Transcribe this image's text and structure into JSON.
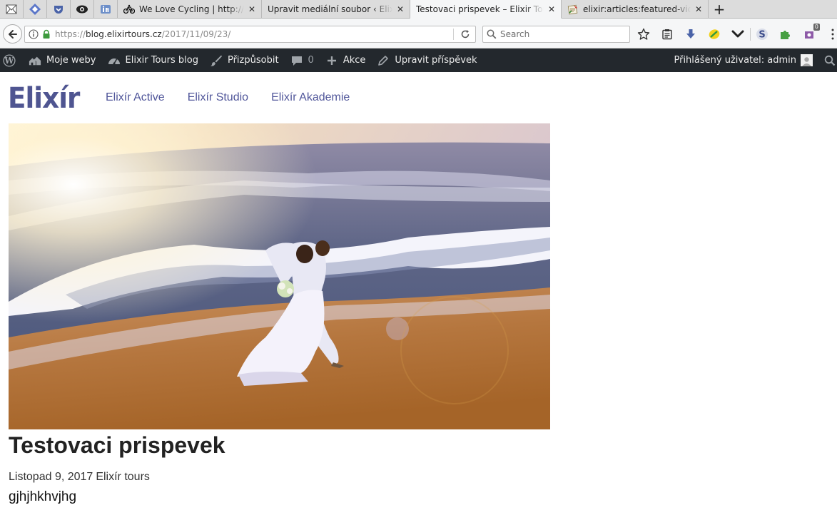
{
  "browser": {
    "tabs": [
      {
        "title": "We Love Cycling | http://w",
        "icon": "cycling-icon"
      },
      {
        "title": "Upravit mediální soubor ‹ Elixír",
        "icon": "none"
      },
      {
        "title": "Testovaci prispevek – Elixir Tours",
        "icon": "none",
        "selected": true
      },
      {
        "title": "elixir:articles:featured-video",
        "icon": "dokuwiki-icon"
      }
    ],
    "pinned_tabs": [
      "mail-icon",
      "diamond-icon",
      "pocket-icon",
      "eye-icon",
      "linkedin-icon"
    ],
    "new_tab_label": "+",
    "close_glyph": "✕",
    "url": {
      "scheme": "https://",
      "host": "blog.elixirtours.cz",
      "path": "/2017/11/09/23/"
    },
    "search_placeholder": "Search",
    "extension_badge": "0"
  },
  "adminbar": {
    "items": [
      {
        "label": "",
        "icon": "wordpress-icon"
      },
      {
        "label": "Moje weby",
        "icon": "sites-icon"
      },
      {
        "label": "Elixir Tours blog",
        "icon": "dashboard-icon"
      },
      {
        "label": "Přizpůsobit",
        "icon": "brush-icon"
      },
      {
        "label": "0",
        "icon": "comment-icon"
      },
      {
        "label": "Akce",
        "icon": "plus-icon"
      },
      {
        "label": "Upravit příspěvek",
        "icon": "pencil-icon"
      }
    ],
    "user_label": "Přihlášený uživatel: admin"
  },
  "site": {
    "logo_text": "Elixír",
    "nav": [
      "Elixír Active",
      "Elixír Studio",
      "Elixír Akademie"
    ]
  },
  "post": {
    "title": "Testovaci prispevek",
    "date": "Listopad 9, 2017",
    "author": "Elixír tours",
    "content": "gjhjhkhvjhg"
  },
  "colors": {
    "brand": "#4f5591",
    "adminbar_bg": "#23282d"
  }
}
